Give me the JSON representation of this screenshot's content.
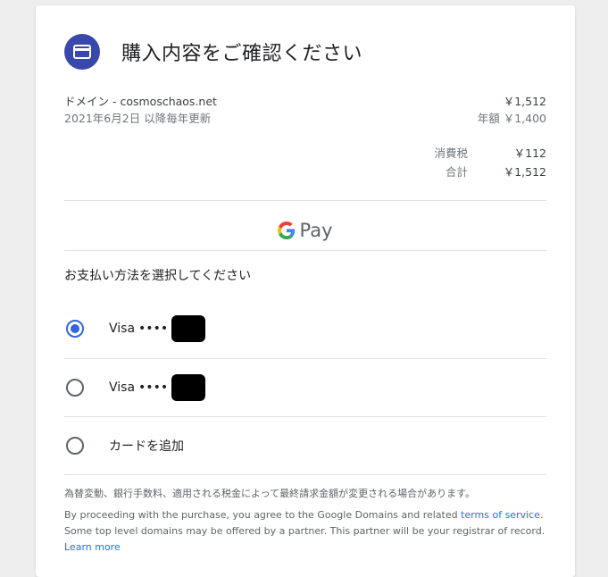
{
  "dialog": {
    "title": "購入内容をご確認ください",
    "icon": "credit-card-icon"
  },
  "line_item": {
    "name": "ドメイン - cosmoschaos.net",
    "price": "￥1,512",
    "renewal": "2021年6月2日 以降毎年更新",
    "annual": "年額 ￥1,400"
  },
  "totals": {
    "tax_label": "消費税",
    "tax_value": "￥112",
    "total_label": "合計",
    "total_value": "￥1,512"
  },
  "gpay": {
    "label": "Pay"
  },
  "payment": {
    "title": "お支払い方法を選択してください",
    "options": [
      {
        "label": "Visa",
        "dots": "••••",
        "selected": true
      },
      {
        "label": "Visa",
        "dots": "••••",
        "selected": false
      },
      {
        "label": "カードを追加",
        "selected": false
      }
    ]
  },
  "notice": "為替変動、銀行手数料、適用される税金によって最終請求金額が変更される場合があります。",
  "legal": {
    "line1": "By proceeding with the purchase, you agree to the Google Domains and related ",
    "terms_link": "terms of service",
    "line1_end": ".",
    "line2": "Some top level domains may be offered by a partner. This partner will be your registrar of record.",
    "learn_more": "Learn more"
  },
  "colors": {
    "accent": "#3949ab",
    "radio": "#3367d6",
    "link": "#1a73e8"
  }
}
